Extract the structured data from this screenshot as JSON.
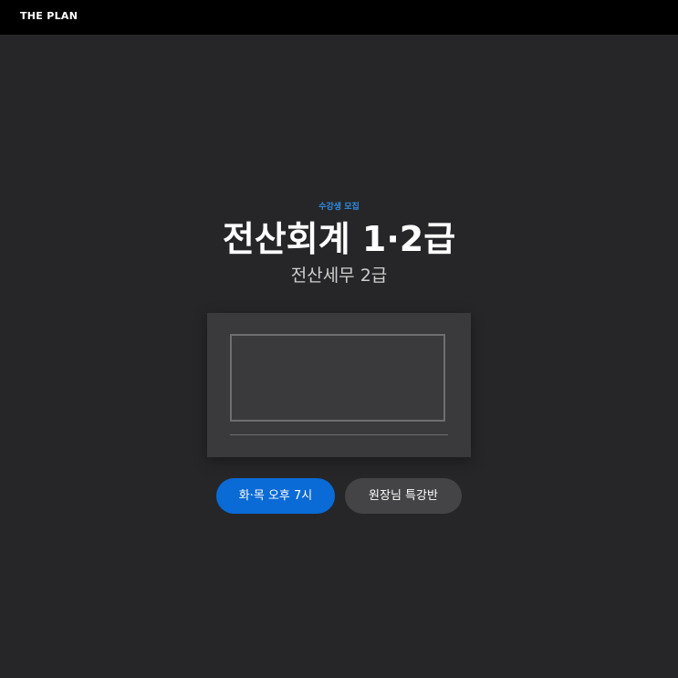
{
  "header": {
    "brand": "THE PLAN"
  },
  "hero": {
    "eyebrow": "수강생 모집",
    "title": "전산회계 1·2급",
    "subtitle": "전산세무 2급"
  },
  "actions": {
    "primary_label": "화·목 오후 7시",
    "secondary_label": "원장님 특강반"
  },
  "colors": {
    "accent": "#0a6ad6",
    "eyebrow": "#2f8fe8",
    "background": "#262628",
    "topbar": "#000000"
  }
}
